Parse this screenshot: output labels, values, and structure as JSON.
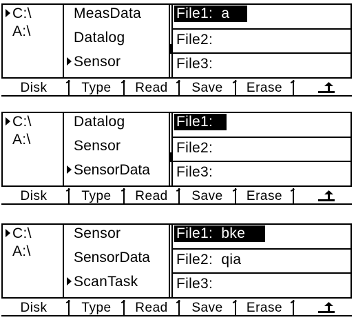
{
  "screens": [
    {
      "disks": [
        {
          "label": "C:\\",
          "selected": true
        },
        {
          "label": "A:\\",
          "selected": false
        }
      ],
      "types": [
        {
          "label": "MeasData",
          "selected": false
        },
        {
          "label": "Datalog",
          "selected": false
        },
        {
          "label": "Sensor",
          "selected": true
        }
      ],
      "files": [
        {
          "label": "File1:  a",
          "selected": true
        },
        {
          "label": "File2:",
          "selected": false
        },
        {
          "label": "File3:",
          "selected": false
        }
      ],
      "softkeys": [
        "Disk",
        "Type",
        "Read",
        "Save",
        "Erase"
      ],
      "back_icon": "return-arrow-icon"
    },
    {
      "disks": [
        {
          "label": "C:\\",
          "selected": true
        },
        {
          "label": "A:\\",
          "selected": false
        }
      ],
      "types": [
        {
          "label": "Datalog",
          "selected": false
        },
        {
          "label": "Sensor",
          "selected": false
        },
        {
          "label": "SensorData",
          "selected": true
        }
      ],
      "files": [
        {
          "label": "File1:",
          "selected": true
        },
        {
          "label": "File2:",
          "selected": false
        },
        {
          "label": "File3:",
          "selected": false
        }
      ],
      "softkeys": [
        "Disk",
        "Type",
        "Read",
        "Save",
        "Erase"
      ],
      "back_icon": "return-arrow-icon"
    },
    {
      "disks": [
        {
          "label": "C:\\",
          "selected": true
        },
        {
          "label": "A:\\",
          "selected": false
        }
      ],
      "types": [
        {
          "label": "Sensor",
          "selected": false
        },
        {
          "label": "SensorData",
          "selected": false
        },
        {
          "label": "ScanTask",
          "selected": true
        }
      ],
      "files": [
        {
          "label": "File1:  bke",
          "selected": true
        },
        {
          "label": "File2:  qia",
          "selected": false
        },
        {
          "label": "File3:",
          "selected": false
        }
      ],
      "softkeys": [
        "Disk",
        "Type",
        "Read",
        "Save",
        "Erase"
      ],
      "back_icon": "return-arrow-icon"
    }
  ]
}
